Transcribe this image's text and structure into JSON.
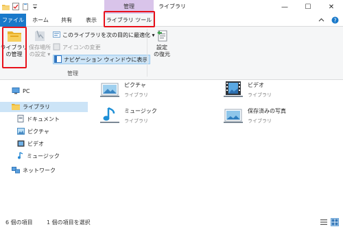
{
  "window": {
    "context_group": "管理",
    "title": "ライブラリ",
    "controls": {
      "minimize": "—",
      "maximize": "☐",
      "close": "✕"
    }
  },
  "tabs": {
    "file": "ファイル",
    "home": "ホーム",
    "share": "共有",
    "view": "表示",
    "library_tools": "ライブラリ ツール"
  },
  "ribbon": {
    "manage_library": {
      "line1": "ライブラリ",
      "line2": "の管理"
    },
    "save_location": {
      "line1": "保存場所",
      "line2": "の設定 ▾"
    },
    "optimize": "このライブラリを次の目的に最適化 ▾",
    "change_icon": "アイコンの変更",
    "show_in_nav": "ナビゲーション ウィンドウに表示",
    "restore_settings": {
      "line1": "設定",
      "line2": "の復元"
    },
    "group_label": "管理"
  },
  "nav": {
    "pc": "PC",
    "libraries": "ライブラリ",
    "documents": "ドキュメント",
    "pictures": "ピクチャ",
    "videos": "ビデオ",
    "music": "ミュージック",
    "network": "ネットワーク"
  },
  "content": {
    "items": [
      {
        "name": "ピクチャ",
        "kind": "ライブラリ"
      },
      {
        "name": "ビデオ",
        "kind": "ライブラリ"
      },
      {
        "name": "ミュージック",
        "kind": "ライブラリ"
      },
      {
        "name": "保存済みの写真",
        "kind": "ライブラリ"
      }
    ]
  },
  "status": {
    "item_count": "6 個の項目",
    "selected": "1 個の項目を選択"
  },
  "colors": {
    "file_tab": "#1979ca",
    "context_group": "#d9c4ea",
    "selection": "#cce4f7",
    "highlight_box": "#e8101a"
  }
}
